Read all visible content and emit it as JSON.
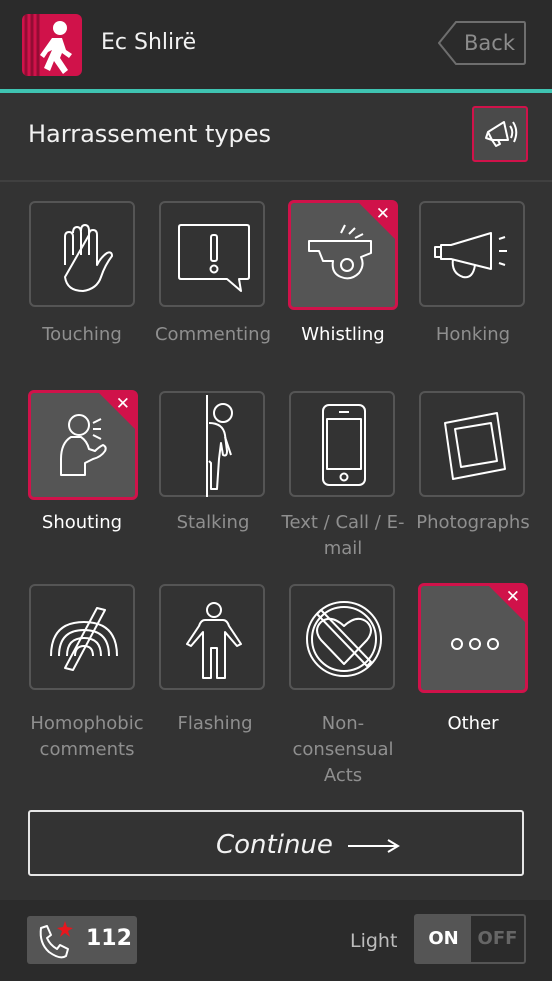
{
  "header": {
    "app_title": "Ec Shlirë",
    "back_label": "Back"
  },
  "section": {
    "title": "Harrassement types"
  },
  "types": [
    {
      "label": "Touching",
      "icon": "hand-icon",
      "selected": false
    },
    {
      "label": "Commenting",
      "icon": "speech-bubble-icon",
      "selected": false
    },
    {
      "label": "Whistling",
      "icon": "whistle-icon",
      "selected": true
    },
    {
      "label": "Honking",
      "icon": "horn-icon",
      "selected": false
    },
    {
      "label": "Shouting",
      "icon": "shouting-person-icon",
      "selected": true
    },
    {
      "label": "Stalking",
      "icon": "stalker-icon",
      "selected": false
    },
    {
      "label": "Text / Call / E-mail",
      "icon": "phone-icon",
      "selected": false
    },
    {
      "label": "Photographs",
      "icon": "photo-icon",
      "selected": false
    },
    {
      "label": "Homophobic comments",
      "icon": "rainbow-crossed-icon",
      "selected": false
    },
    {
      "label": "Flashing",
      "icon": "flasher-icon",
      "selected": false
    },
    {
      "label": "Non-consensual Acts",
      "icon": "heart-forbidden-icon",
      "selected": false
    },
    {
      "label": "Other",
      "icon": "ellipsis-icon",
      "selected": true
    }
  ],
  "continue_label": "Continue",
  "footer": {
    "emergency_number": "112",
    "light_label": "Light",
    "toggle_on": "ON",
    "toggle_off": "OFF"
  },
  "colors": {
    "accent": "#d0124a",
    "teal": "#3fc4b2",
    "background": "#333333"
  }
}
